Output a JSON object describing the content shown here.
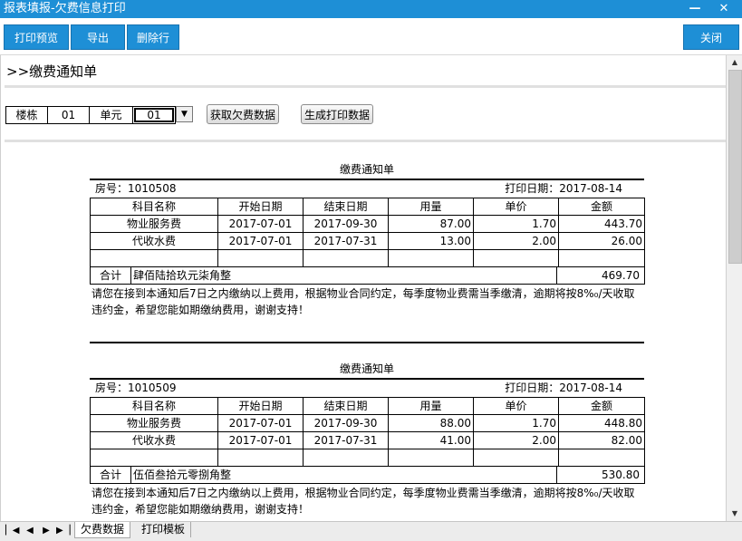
{
  "window": {
    "title": "报表填报-欠费信息打印",
    "minimize_glyph": "—",
    "close_glyph": "✕"
  },
  "toolbar": {
    "print_preview": "打印预览",
    "export": "导出",
    "delete_row": "删除行",
    "close": "关闭"
  },
  "page": {
    "heading": ">>缴费通知单"
  },
  "filter": {
    "building_label": "楼栋",
    "building_value": "01",
    "unit_label": "单元",
    "unit_value": "01",
    "fetch_button": "获取欠费数据",
    "generate_button": "生成打印数据"
  },
  "table_headers": [
    "科目名称",
    "开始日期",
    "结束日期",
    "用量",
    "单价",
    "金额"
  ],
  "notices": [
    {
      "title": "缴费通知单",
      "room_label": "房号：",
      "room": "1010508",
      "date_label": "打印日期：",
      "date": "2017-08-14",
      "rows": [
        [
          "物业服务费",
          "2017-07-01",
          "2017-09-30",
          "87.00",
          "1.70",
          "443.70"
        ],
        [
          "代收水费",
          "2017-07-01",
          "2017-07-31",
          "13.00",
          "2.00",
          "26.00"
        ]
      ],
      "total_label": "合计",
      "total_words": "肆佰陆拾玖元柒角整",
      "total": "469.70",
      "message_line1": "请您在接到本通知后7日之内缴纳以上费用，根据物业合同约定，每季度物业费需当季缴清，逾期将按8%₀/天收取",
      "message_line2": "违约金，希望您能如期缴纳费用，谢谢支持！"
    },
    {
      "title": "缴费通知单",
      "room_label": "房号：",
      "room": "1010509",
      "date_label": "打印日期：",
      "date": "2017-08-14",
      "rows": [
        [
          "物业服务费",
          "2017-07-01",
          "2017-09-30",
          "88.00",
          "1.70",
          "448.80"
        ],
        [
          "代收水费",
          "2017-07-01",
          "2017-07-31",
          "41.00",
          "2.00",
          "82.00"
        ]
      ],
      "total_label": "合计",
      "total_words": "伍佰叁拾元零捌角整",
      "total": "530.80",
      "message_line1": "请您在接到本通知后7日之内缴纳以上费用，根据物业合同约定，每季度物业费需当季缴清，逾期将按8%₀/天收取",
      "message_line2": "违约金，希望您能如期缴纳费用，谢谢支持！"
    }
  ],
  "sheet_tabs": {
    "tab1": "欠费数据",
    "tab2": "打印模板"
  },
  "icons": {
    "first": "first-page-icon",
    "prev": "prev-page-icon",
    "next": "next-page-icon",
    "last": "last-page-icon"
  },
  "colors": {
    "accent": "#1e8fd6"
  }
}
